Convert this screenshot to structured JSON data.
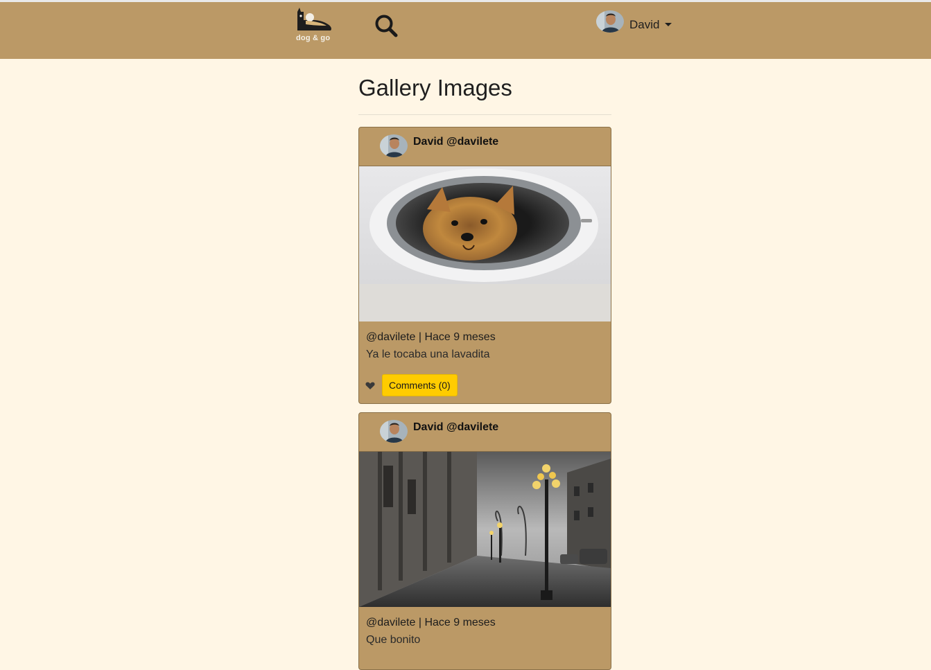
{
  "brand": {
    "logo_text": "dog & go"
  },
  "navbar": {
    "search_icon": "search-icon",
    "user": {
      "name": "David"
    }
  },
  "page": {
    "title": "Gallery Images"
  },
  "posts": [
    {
      "author": "David @davilete",
      "meta": "@davilete | Hace 9 meses",
      "caption": "Ya le tocaba una lavadita",
      "comments_label": "Comments (0)",
      "image": "yorkshire-terrier-in-washing-machine"
    },
    {
      "author": "David @davilete",
      "meta": "@davilete | Hace 9 meses",
      "caption": "Que bonito",
      "image": "rainy-city-street-with-lampposts"
    }
  ],
  "colors": {
    "navbar": "#bb9966",
    "background": "#fff6e5",
    "card": "#bb9966",
    "button": "#ffcc00"
  }
}
